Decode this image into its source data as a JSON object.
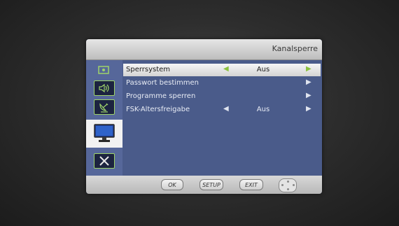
{
  "header": {
    "title": "Kanalsperre"
  },
  "sidebar": {
    "icons": [
      "tv-settings-icon",
      "audio-icon",
      "satellite-icon",
      "monitor-icon",
      "tools-icon"
    ]
  },
  "menu": {
    "items": [
      {
        "label": "Sperrsystem",
        "value": "Aus",
        "left_arrow": "◀",
        "right_arrow": "▶"
      },
      {
        "label": "Passwort bestimmen",
        "right_arrow": "▶"
      },
      {
        "label": "Programme sperren",
        "right_arrow": "▶"
      },
      {
        "label": "FSK-Altersfreigabe",
        "value": "Aus",
        "left_arrow": "◀",
        "right_arrow": "▶"
      }
    ]
  },
  "footer": {
    "ok": "OK",
    "setup": "SETUP",
    "exit": "EXIT"
  },
  "colors": {
    "accent": "#8cc23e",
    "panel": "#4a5b8a"
  }
}
